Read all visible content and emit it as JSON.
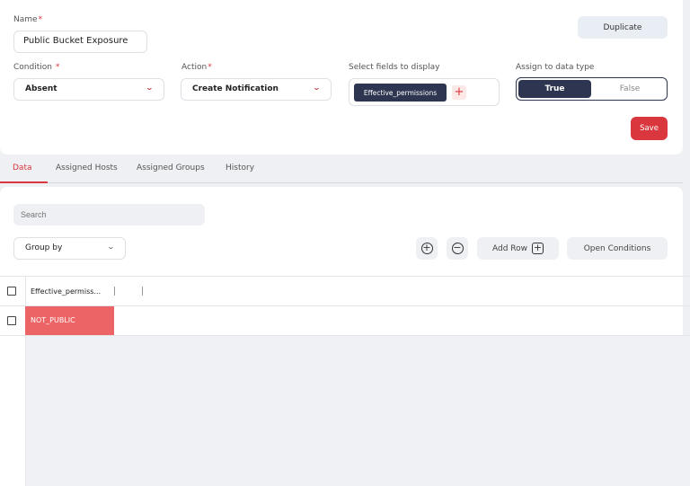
{
  "form": {
    "name_label": "Name",
    "required_mark": "*",
    "name_value": "Public Bucket Exposure",
    "duplicate_label": "Duplicate",
    "condition_label": "Condition",
    "condition_value": "Absent",
    "action_label": "Action",
    "action_value": "Create Notification",
    "fields_label": "Select fields to display",
    "selected_field": "Effective_permissions",
    "add_field_glyph": "+",
    "assign_label": "Assign to data type",
    "toggle_true": "True",
    "toggle_false": "False",
    "toggle_selected": "True",
    "save_label": "Save",
    "chevron_glyph": "⌄"
  },
  "tabs": [
    {
      "label": "Data",
      "active": true
    },
    {
      "label": "Assigned Hosts",
      "active": false
    },
    {
      "label": "Assigned Groups",
      "active": false
    },
    {
      "label": "History",
      "active": false
    }
  ],
  "toolbar": {
    "search_placeholder": "Search",
    "group_by_label": "Group by",
    "add_column_glyph": "+",
    "remove_column_glyph": "−",
    "add_row_label": "Add Row",
    "add_row_glyph": "+",
    "open_conditions_label": "Open Conditions"
  },
  "table": {
    "columns": [
      "Effective_permiss..."
    ],
    "rows": [
      [
        "NOT_PUBLIC"
      ]
    ]
  },
  "colors": {
    "accent_red": "#d9363e",
    "navy": "#2d3550",
    "cell_red": "#ec6466"
  },
  "icons": [
    "chevron-down-icon",
    "plus-icon",
    "plus-circle-icon",
    "minus-circle-icon",
    "plus-square-icon",
    "checkbox-icon"
  ]
}
